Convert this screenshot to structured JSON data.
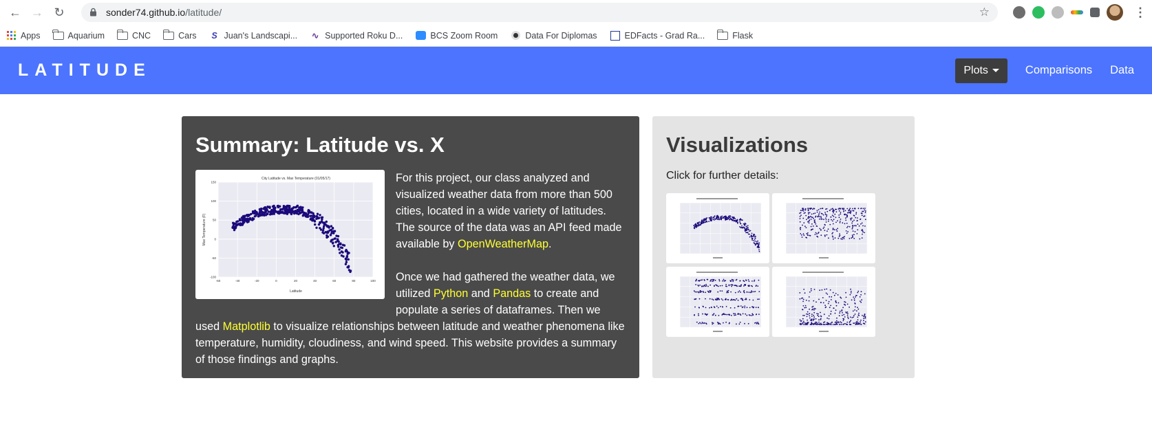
{
  "browser": {
    "url_host": "sonder74.github.io",
    "url_path": "/latitude/",
    "bookmarks": [
      {
        "label": "Apps",
        "icon": "apps-grid-icon"
      },
      {
        "label": "Aquarium",
        "icon": "folder-icon"
      },
      {
        "label": "CNC",
        "icon": "folder-icon"
      },
      {
        "label": "Cars",
        "icon": "folder-icon"
      },
      {
        "label": "Juan's Landscapi...",
        "icon": "site-s-icon"
      },
      {
        "label": "Supported Roku D...",
        "icon": "roku-icon"
      },
      {
        "label": "BCS Zoom Room",
        "icon": "zoom-icon"
      },
      {
        "label": "Data For Diplomas",
        "icon": "dot-icon"
      },
      {
        "label": "EDFacts - Grad Ra...",
        "icon": "edfacts-icon"
      },
      {
        "label": "Flask",
        "icon": "folder-icon"
      }
    ]
  },
  "navbar": {
    "brand": "LATITUDE",
    "plots_label": "Plots",
    "comparisons_label": "Comparisons",
    "data_label": "Data",
    "color": "#4c74ff"
  },
  "summary": {
    "title": "Summary: Latitude vs. X",
    "p1_a": "For this project, our class analyzed and visualized weather data from more than 500 cities, located in a wide variety of latitudes. The source of the data was an API feed made available by ",
    "p1_link": "OpenWeatherMap",
    "p1_b": ".",
    "p2_a": "Once we had gathered the weather data, we utilized ",
    "p2_link1": "Python",
    "p2_and": " and ",
    "p2_link2": "Pandas",
    "p2_b": " to create and populate a series of dataframes. Then we used ",
    "p2_link3": "Matplotlib",
    "p2_c": " to visualize relationships between latitude and weather phenomena like temperature, humidity, cloudiness, and wind speed. This website provides a summary of those findings and graphs.",
    "link_color": "#ffff33",
    "plot": {
      "title": "City Latitude vs. Max Temperature (01/05/17)",
      "xlabel": "Latitude",
      "ylabel": "Max Temperature (F)",
      "xticks": [
        "-60",
        "-40",
        "-20",
        "0",
        "20",
        "40",
        "60",
        "80",
        "100"
      ],
      "yticks": [
        "150",
        "100",
        "50",
        "0",
        "-50",
        "-100"
      ]
    }
  },
  "visualizations": {
    "title": "Visualizations",
    "subtitle": "Click for further details:",
    "thumbnails": [
      {
        "name": "thumb-temperature"
      },
      {
        "name": "thumb-humidity"
      },
      {
        "name": "thumb-cloudiness"
      },
      {
        "name": "thumb-wind-speed"
      }
    ]
  }
}
